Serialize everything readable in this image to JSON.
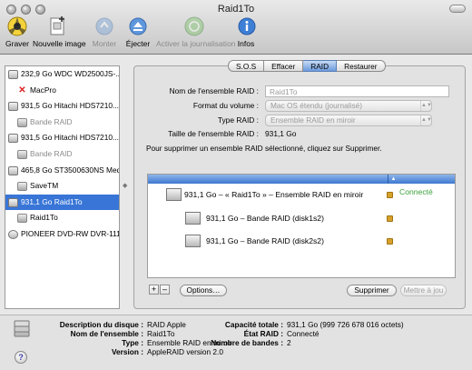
{
  "window": {
    "title": "Raid1To"
  },
  "toolbar": {
    "items": [
      {
        "label": "Graver",
        "enabled": true,
        "icon": "burn-icon"
      },
      {
        "label": "Nouvelle image",
        "enabled": true,
        "icon": "new-image-icon"
      },
      {
        "label": "Monter",
        "enabled": false,
        "icon": "mount-icon"
      },
      {
        "label": "Éjecter",
        "enabled": true,
        "icon": "eject-icon"
      },
      {
        "label": "Activer la journalisation",
        "enabled": false,
        "icon": "journaling-icon"
      },
      {
        "label": "Infos",
        "enabled": true,
        "icon": "info-icon"
      }
    ]
  },
  "sidebar": {
    "items": [
      {
        "label": "232,9 Go WDC WD2500JS-..."
      },
      {
        "label": "MacPro"
      },
      {
        "label": "931,5 Go Hitachi HDS7210..."
      },
      {
        "label": "Bande RAID"
      },
      {
        "label": "931,5 Go Hitachi HDS7210..."
      },
      {
        "label": "Bande RAID"
      },
      {
        "label": "465,8 Go ST3500630NS Med"
      },
      {
        "label": "SaveTM"
      },
      {
        "label": "931,1 Go Raid1To"
      },
      {
        "label": "Raid1To"
      },
      {
        "label": "PIONEER DVD-RW DVR-111"
      }
    ]
  },
  "tabs": [
    "S.O.S",
    "Effacer",
    "RAID",
    "Restaurer"
  ],
  "active_tab": "RAID",
  "form": {
    "name_label": "Nom de l'ensemble RAID :",
    "name_value": "Raid1To",
    "format_label": "Format du volume :",
    "format_value": "Mac OS étendu (journalisé)",
    "type_label": "Type RAID :",
    "type_value": "Ensemble RAID en miroir",
    "size_label": "Taille de l'ensemble RAID :",
    "size_value": "931,1 Go"
  },
  "note": "Pour supprimer un ensemble RAID sélectionné, cliquez sur Supprimer.",
  "raid_list": {
    "set": {
      "label": "931,1 Go – « Raid1To » – Ensemble RAID en miroir",
      "status": "Connecté"
    },
    "members": [
      {
        "label": "931,1 Go – Bande RAID (disk1s2)"
      },
      {
        "label": "931,1 Go – Bande RAID (disk2s2)"
      }
    ]
  },
  "buttons": {
    "add": "+",
    "remove": "–",
    "options": "Options…",
    "delete": "Supprimer",
    "update": "Mettre à jou"
  },
  "info": {
    "left": [
      {
        "label": "Description du disque :",
        "value": "RAID Apple"
      },
      {
        "label": "Nom de l'ensemble :",
        "value": "Raid1To"
      },
      {
        "label": "Type :",
        "value": "Ensemble RAID en miroir"
      },
      {
        "label": "Version :",
        "value": "AppleRAID version 2.0"
      }
    ],
    "right": [
      {
        "label": "Capacité totale :",
        "value": "931,1 Go (999 726 678 016 octets)"
      },
      {
        "label": "État RAID :",
        "value": "Connecté"
      },
      {
        "label": "Nombre de bandes :",
        "value": "2"
      }
    ]
  },
  "help": "?",
  "colors": {
    "selection": "#3875d7",
    "connected": "#3ba03b",
    "header": "#3d78d0"
  }
}
